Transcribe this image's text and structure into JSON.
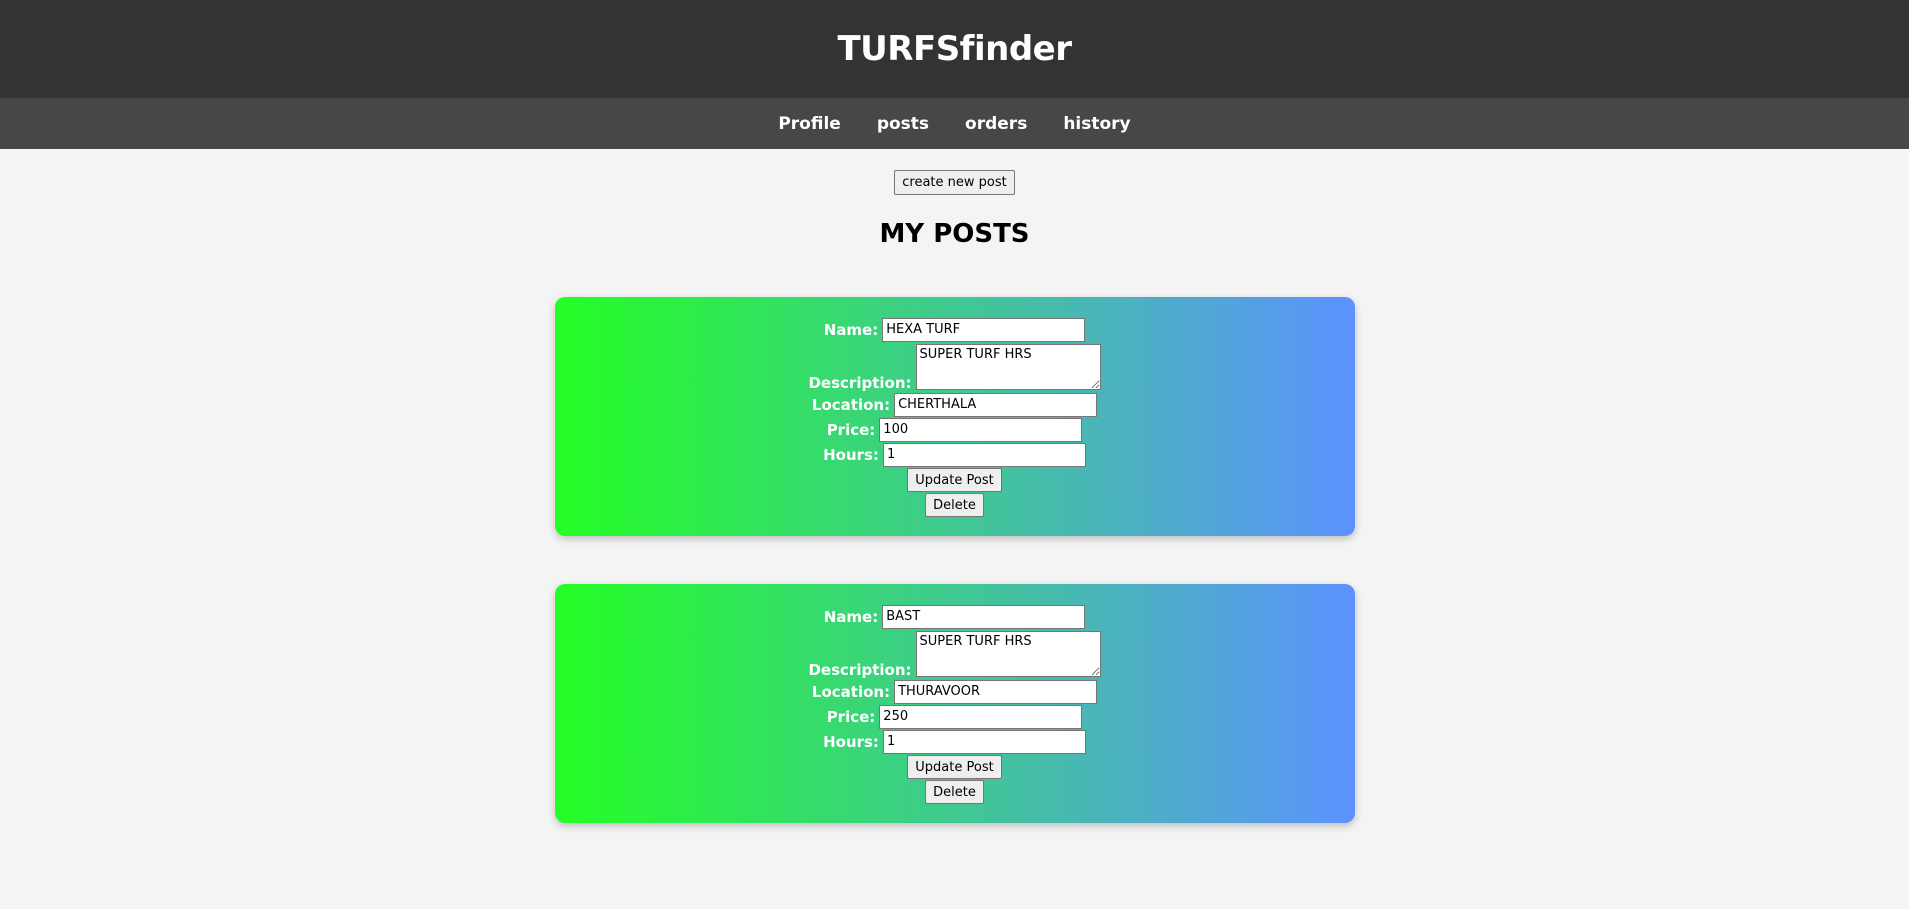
{
  "header": {
    "title": "TURFSfinder"
  },
  "nav": {
    "items": [
      {
        "label": "Profile"
      },
      {
        "label": "posts"
      },
      {
        "label": "orders"
      },
      {
        "label": "history"
      }
    ]
  },
  "main": {
    "create_button_label": "create new post",
    "title": "MY POSTS",
    "field_labels": {
      "name": "Name:",
      "description": "Description:",
      "location": "Location:",
      "price": "Price:",
      "hours": "Hours:"
    },
    "update_label": "Update Post",
    "delete_label": "Delete",
    "posts": [
      {
        "name": "HEXA TURF",
        "description": "SUPER TURF HRS",
        "location": "CHERTHALA",
        "price": "100",
        "hours": "1"
      },
      {
        "name": "BAST",
        "description": "SUPER TURF HRS",
        "location": "THURAVOOR",
        "price": "250",
        "hours": "1"
      }
    ]
  },
  "colors": {
    "header_bg": "#333333",
    "nav_bg": "#474747",
    "page_bg": "#f4f4f4",
    "card_gradient_start": "#24ff24",
    "card_gradient_end": "#5c92ff"
  }
}
